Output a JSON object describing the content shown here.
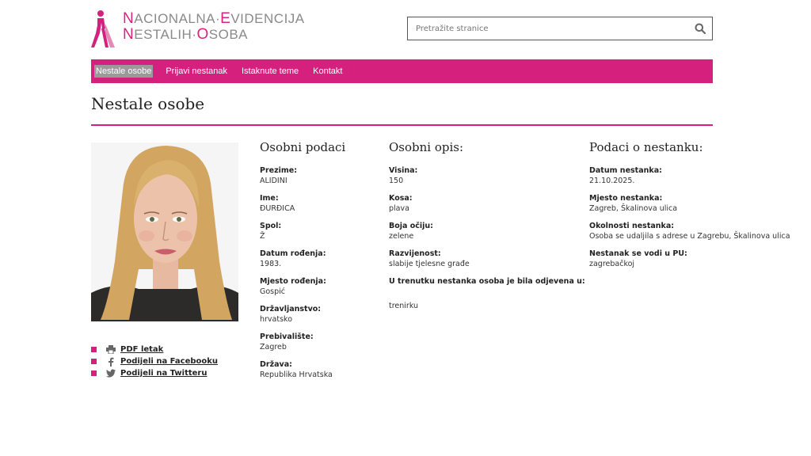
{
  "logo": {
    "line1": [
      {
        "cap": "N",
        "rest": "ACIONALNA"
      },
      {
        "sep": "·"
      },
      {
        "cap": "E",
        "rest": "VIDENCIJA"
      }
    ],
    "line2": [
      {
        "cap": "N",
        "rest": "ESTALIH"
      },
      {
        "sep": "·"
      },
      {
        "cap": "O",
        "rest": "SOBA"
      }
    ],
    "line1_text": "NACIONALNA·EVIDENCIJA",
    "line2_text": "NESTALIH·OSOBA"
  },
  "search": {
    "placeholder": "Pretražite stranice",
    "value": ""
  },
  "nav": {
    "items": [
      "Nestale osobe",
      "Prijavi nestanak",
      "Istaknute teme",
      "Kontakt"
    ],
    "active_index": 0
  },
  "page_title": "Nestale osobe",
  "actions": {
    "pdf": "PDF letak",
    "facebook": "Podijeli na Facebooku",
    "twitter": "Podijeli na Twitteru"
  },
  "personal": {
    "heading": "Osobni podaci",
    "fields": [
      {
        "label": "Prezime:",
        "value": "ALIDINI"
      },
      {
        "label": "Ime:",
        "value": "ĐURĐICA"
      },
      {
        "label": "Spol:",
        "value": "Ž"
      },
      {
        "label": "Datum rođenja:",
        "value": "1983."
      },
      {
        "label": "Mjesto rođenja:",
        "value": "Gospić"
      },
      {
        "label": "Državljanstvo:",
        "value": "hrvatsko"
      },
      {
        "label": "Prebivalište:",
        "value": "Zagreb"
      },
      {
        "label": "Država:",
        "value": "Republika Hrvatska"
      }
    ]
  },
  "description": {
    "heading": "Osobni opis:",
    "fields": [
      {
        "label": "Visina:",
        "value": "150"
      },
      {
        "label": "Kosa:",
        "value": "plava"
      },
      {
        "label": "Boja očiju:",
        "value": "zelene"
      },
      {
        "label": "Razvijenost:",
        "value": "slabije tjelesne građe"
      }
    ],
    "clothes_label": "U trenutku nestanka osoba je bila odjevena u:",
    "clothes_value": "trenirku"
  },
  "disappearance": {
    "heading": "Podaci o nestanku:",
    "fields": [
      {
        "label": "Datum nestanka:",
        "value": "21.10.2025."
      },
      {
        "label": "Mjesto nestanka:",
        "value": "Zagreb, Škalinova ulica"
      },
      {
        "label": "Okolnosti nestanka:",
        "value": "Osoba se udaljila s adrese u Zagrebu, Škalinova ulica"
      },
      {
        "label": "Nestanak se vodi u PU:",
        "value": "zagrebačkoj"
      }
    ]
  },
  "colors": {
    "accent": "#d6207e",
    "text": "#222222",
    "logo_gray": "#8a8a8a"
  },
  "icons": {
    "search": "search-icon",
    "print": "printer-icon",
    "facebook": "facebook-icon",
    "twitter": "twitter-icon"
  }
}
